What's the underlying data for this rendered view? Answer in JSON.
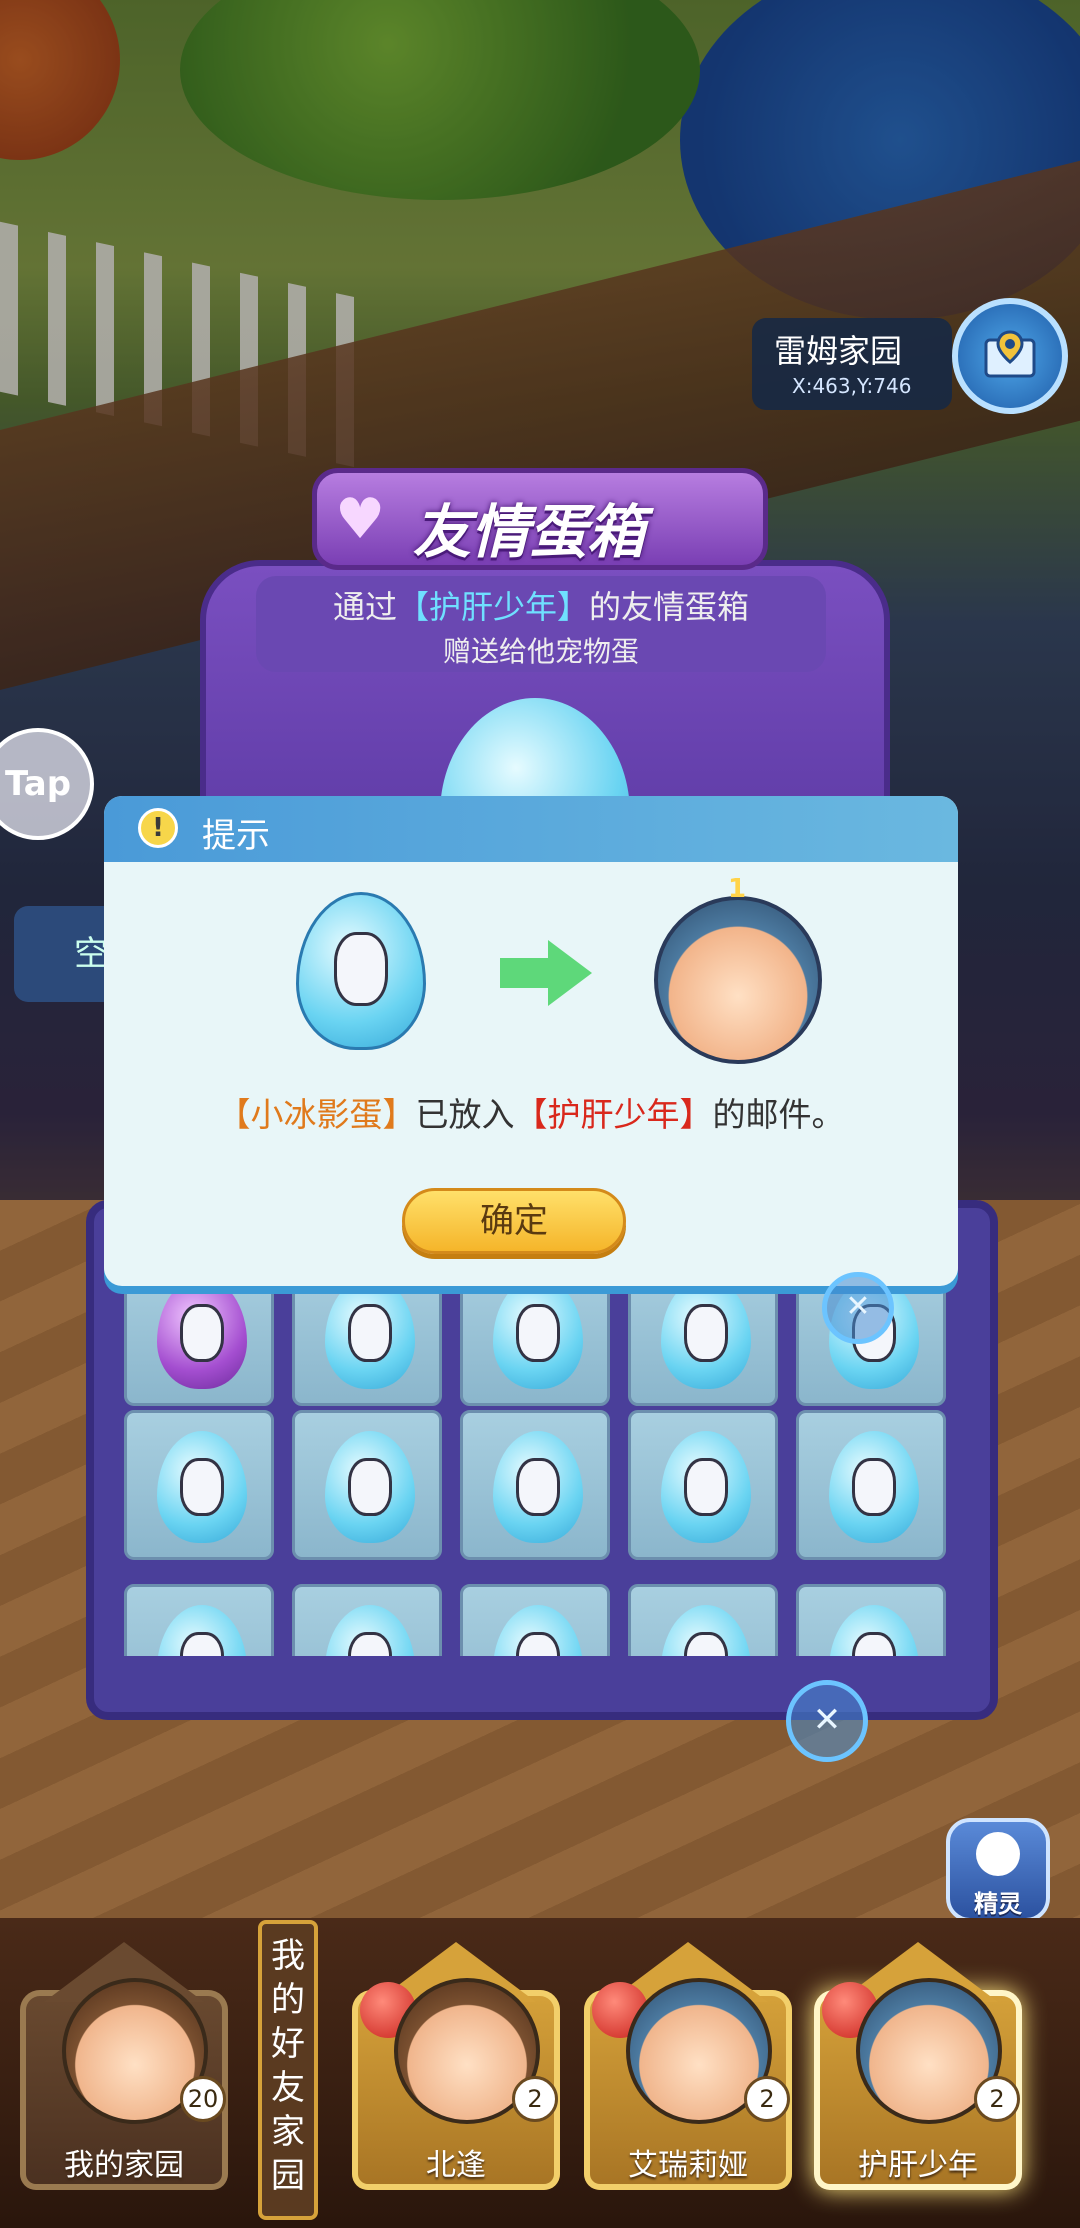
{
  "location": {
    "name": "雷姆家园",
    "coords": "X:463,Y:746"
  },
  "tap_button": "Tap",
  "side_button": "空",
  "egg_box": {
    "title": "友情蛋箱",
    "line1_prefix": "通过",
    "line1_name": "【护肝少年】",
    "line1_suffix": "的友情蛋箱",
    "line2": "赠送给他宠物蛋"
  },
  "dialog": {
    "title": "提示",
    "avatar_level": "1",
    "msg_egg": "【小冰影蛋】",
    "msg_mid": "已放入",
    "msg_player": "【护肝少年】",
    "msg_end": "的邮件。",
    "confirm": "确定"
  },
  "friends": {
    "label": "我的好友家园",
    "mine": {
      "name": "我的家园",
      "count": "20"
    },
    "list": [
      {
        "name": "北逢",
        "count": "2"
      },
      {
        "name": "艾瑞莉娅",
        "count": "2"
      },
      {
        "name": "护肝少年",
        "count": "2"
      }
    ]
  },
  "spirit_button": "精灵",
  "colors": {
    "accent_blue": "#4a9ad8",
    "confirm_yellow": "#f5b52a",
    "highlight_orange": "#e07a1c",
    "highlight_red": "#d9281c"
  }
}
